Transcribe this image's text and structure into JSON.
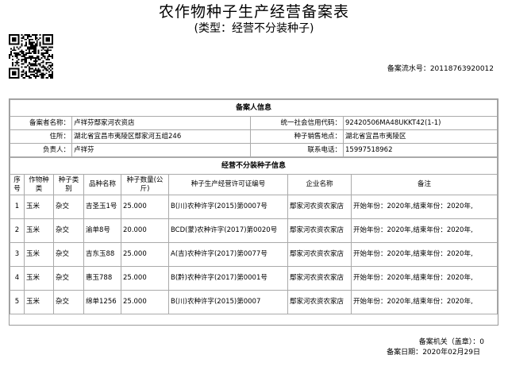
{
  "header": {
    "title": "农作物种子生产经营备案表",
    "subtitle": "(类型：经营不分装种子)",
    "serial_label": "备案流水号：",
    "serial_value": "20118763920012"
  },
  "filer_section": {
    "heading": "备案人信息",
    "filer_name_label": "备案者名称：",
    "filer_name": "卢祥芬鄢家河农资店",
    "credit_code_label": "统一社会信用代码：",
    "credit_code": "92420506MA48UKKT42(1-1)",
    "address_label": "住所：",
    "address": "湖北省宜昌市夷陵区鄢家河五组246",
    "sales_location_label": "种子销售地点：",
    "sales_location": "湖北省宜昌市夷陵区",
    "responsible_label": "负责人：",
    "responsible": "卢祥芬",
    "phone_label": "联系电话：",
    "phone": "15997518962"
  },
  "seed_section": {
    "heading": "经营不分装种子信息",
    "columns": [
      "序号",
      "作物种类",
      "种子类别",
      "品种名称",
      "种子数量(公斤)",
      "种子生产经营许可证编号",
      "企业名称",
      "备注"
    ],
    "rows": [
      {
        "no": "1",
        "crop": "玉米",
        "category": "杂交",
        "variety": "吉圣玉1号",
        "qty": "25.000",
        "license": "B(川)农种许字(2015)第0007号",
        "company": "鄢家河农资农家店",
        "note": "开始年份：2020年,结束年份：2020年,"
      },
      {
        "no": "2",
        "crop": "玉米",
        "category": "杂交",
        "variety": "渝单8号",
        "qty": "20.000",
        "license": "BCD(蒙)农种许字(2017)第0020号",
        "company": "鄢家河农资农家店",
        "note": "开始年份：2020年,结束年份：2020年,"
      },
      {
        "no": "3",
        "crop": "玉米",
        "category": "杂交",
        "variety": "吉东玉88",
        "qty": "25.000",
        "license": "A(吉)农种许字(2017)第0077号",
        "company": "鄢家河农资农家店",
        "note": "开始年份：2020年,结束年份：2020年,"
      },
      {
        "no": "4",
        "crop": "玉米",
        "category": "杂交",
        "variety": "惠玉788",
        "qty": "25.000",
        "license": "B(黔)农种许字(2017)第0001号",
        "company": "鄢家河农资农家店",
        "note": "开始年份：2020年,结束年份：2020年,"
      },
      {
        "no": "5",
        "crop": "玉米",
        "category": "杂交",
        "variety": "绵单1256",
        "qty": "25.000",
        "license": "B(川)农种许字(2015)第0007",
        "company": "鄢家河农资农家店",
        "note": "开始年份：2020年,结束年份：2020年,"
      }
    ]
  },
  "footer": {
    "office_label": "备案机关（盖章）：",
    "office_value": "0",
    "date_label": "备案日期：",
    "date_value": "2020年02月29日"
  },
  "qr_icon": "qr-code-icon"
}
